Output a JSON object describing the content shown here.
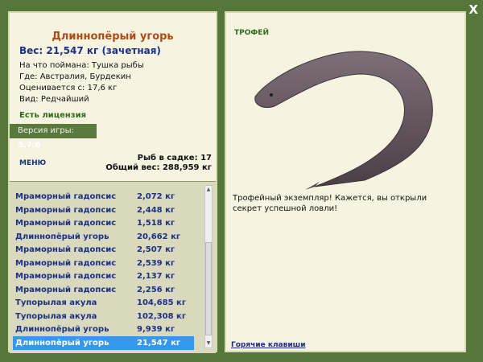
{
  "window": {
    "close_label": "X"
  },
  "catch": {
    "fish_name": "Длиннопёрый угорь",
    "weight_line": "Вес: 21,547 кг (зачетная)",
    "bait": "На что поймана: Тушка рыбы",
    "location": "Где: Австралия, Бурдекин",
    "value": "Оценивается с: 17,6 кг",
    "species": "Вид: Редчайший"
  },
  "license": "Есть лицензия",
  "version": {
    "label": "Версия игры:",
    "number": "3.7.6"
  },
  "menu_label": "МЕНЮ",
  "keepnet": {
    "count_line": "Рыб в садке: 17",
    "total_line": "Общий вес: 288,959 кг"
  },
  "fish_list": [
    {
      "name": "Мраморный гадопсис",
      "weight": "2,072 кг"
    },
    {
      "name": "Мраморный гадопсис",
      "weight": "2,448 кг"
    },
    {
      "name": "Мраморный гадопсис",
      "weight": "1,518 кг"
    },
    {
      "name": "Длиннопёрый угорь",
      "weight": "20,662 кг"
    },
    {
      "name": "Мраморный гадопсис",
      "weight": "2,507 кг"
    },
    {
      "name": "Мраморный гадопсис",
      "weight": "2,539 кг"
    },
    {
      "name": "Мраморный гадопсис",
      "weight": "2,137 кг"
    },
    {
      "name": "Мраморный гадопсис",
      "weight": "2,256 кг"
    },
    {
      "name": "Тупорылая акула",
      "weight": "104,685 кг"
    },
    {
      "name": "Тупорылая акула",
      "weight": "102,308 кг"
    },
    {
      "name": "Длиннопёрый угорь",
      "weight": "9,939 кг"
    },
    {
      "name": "Длиннопёрый угорь",
      "weight": "21,547 кг",
      "selected": true
    }
  ],
  "trophy": {
    "title": "ТРОФЕЙ",
    "message": "Трофейный экземпляр! Кажется, вы открыли секрет успешной ловли!"
  },
  "hotkeys_label": "Горячие клавиши",
  "colors": {
    "frame": "#55773a",
    "panel": "#f6f4e0",
    "fish_name": "#b04a12",
    "list_text": "#1c2f86",
    "selection": "#3399ee"
  }
}
